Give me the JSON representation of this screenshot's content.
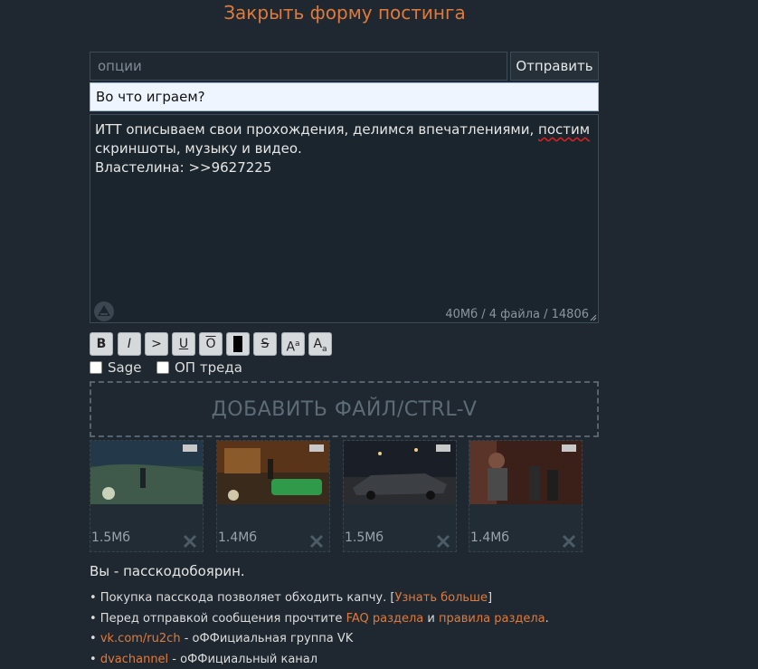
{
  "form": {
    "close_label": "Закрыть форму постинга",
    "options_placeholder": "опции",
    "submit_label": "Отправить",
    "subject_value": "Во что играем?",
    "comment": {
      "line1_before": "ИТТ описываем свои прохождения, делимся впечатлениями, ",
      "line1_misspelled": "постим",
      "line2": "скриншоты, музыку и видео.",
      "line3": "Властелина: >>9627225"
    },
    "counter": "40Мб / 4 файла / 14806"
  },
  "format_buttons": {
    "bold": "B",
    "italic": "I",
    "quote": ">",
    "underline": "U",
    "overline": "O",
    "strike": "S",
    "sup_base": "A",
    "sup_mark": "a",
    "sub_base": "A",
    "sub_mark": "a"
  },
  "checkboxes": {
    "sage": "Sage",
    "op": "ОП треда"
  },
  "dropzone_label": "ДОБАВИТЬ ФАЙЛ/CTRL-V",
  "files": [
    {
      "size": "1.5Мб"
    },
    {
      "size": "1.4Мб"
    },
    {
      "size": "1.5Мб"
    },
    {
      "size": "1.4Мб"
    }
  ],
  "passcode": {
    "title": "Вы - пасскодобоярин.",
    "line1_text": "• Покупка пасскода позволяет обходить капчу. [",
    "line1_link": "Узнать больше",
    "line1_end": "]",
    "line2_text": "• Перед отправкой сообщения прочтите ",
    "line2_link1": "FAQ раздела",
    "line2_and": " и ",
    "line2_link2": "правила раздела",
    "line2_end": ".",
    "line3_bullet": "• ",
    "line3_link": "vk.com/ru2ch",
    "line3_text": " - оФФициальная группа VK",
    "line4_bullet": "• ",
    "line4_link": "dvachannel",
    "line4_text": " - оФФициальный канал"
  },
  "colors": {
    "accent": "#e07a3c",
    "background": "#1f2830",
    "subject_bg": "#eef5ff"
  }
}
